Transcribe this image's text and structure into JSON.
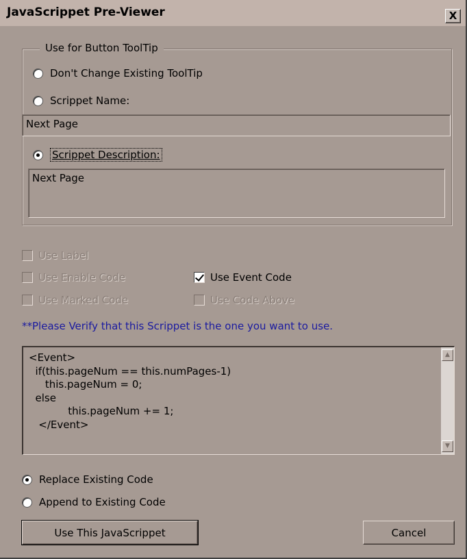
{
  "window": {
    "title": "JavaScrippet Pre-Viewer",
    "close_label": "X"
  },
  "tooltip_group": {
    "legend": "Use for Button ToolTip",
    "options": [
      {
        "label": "Don't Change Existing ToolTip",
        "selected": false
      },
      {
        "label": "Scrippet Name:",
        "selected": false
      },
      {
        "label": "Scrippet Description:",
        "selected": true
      }
    ],
    "name_value": "Next Page",
    "description_value": "Next Page"
  },
  "checkboxes": {
    "use_label": {
      "label": "Use Label",
      "checked": false,
      "enabled": false
    },
    "use_enable_code": {
      "label": "Use Enable Code",
      "checked": false,
      "enabled": false
    },
    "use_event_code": {
      "label": "Use Event Code",
      "checked": true,
      "enabled": true
    },
    "use_marked_code": {
      "label": "Use Marked Code",
      "checked": false,
      "enabled": false
    },
    "use_code_above": {
      "label": "Use Code Above",
      "checked": false,
      "enabled": false
    }
  },
  "verify_message": "**Please Verify that this Scrippet is the one you want to use.",
  "code_lines": [
    "<Event>",
    "  if(this.pageNum == this.numPages-1)",
    "     this.pageNum = 0;",
    "  else",
    "            this.pageNum += 1;",
    "   </Event>"
  ],
  "insert_mode": {
    "options": [
      {
        "label": "Replace Existing Code",
        "selected": true
      },
      {
        "label": "Append to Existing Code",
        "selected": false
      }
    ]
  },
  "buttons": {
    "use": "Use This JavaScrippet",
    "cancel": "Cancel"
  },
  "colors": {
    "dialog_bg": "#a69a93",
    "verify_text": "#1a1aa0"
  }
}
